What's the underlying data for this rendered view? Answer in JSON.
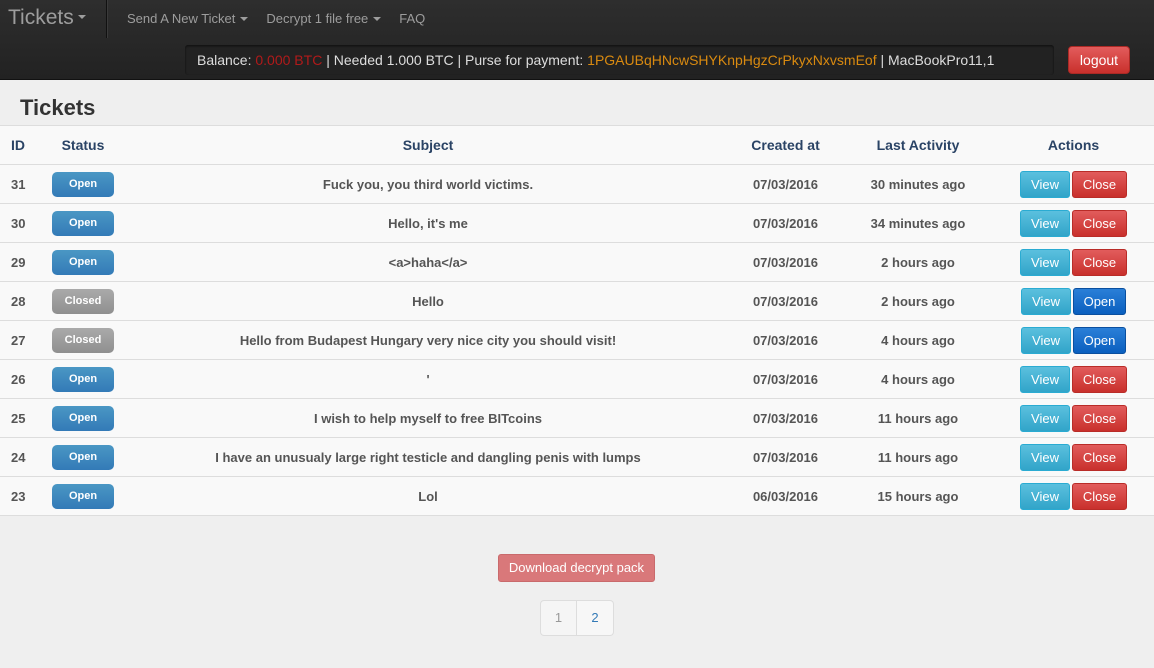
{
  "app": {
    "brand": "Tickets"
  },
  "nav": [
    {
      "label": "Send A New Ticket",
      "dropdown": true
    },
    {
      "label": "Decrypt 1 file free",
      "dropdown": true
    },
    {
      "label": "FAQ",
      "dropdown": false
    }
  ],
  "balance": {
    "label": "Balance:",
    "value": "0.000 BTC",
    "needed": "| Needed 1.000 BTC | Purse for payment:",
    "purse": "1PGAUBqHNcwSHYKnpHgzCrPkyxNxvsmEof",
    "machine": "| MacBookPro11,1"
  },
  "logout_label": "logout",
  "page_title": "Tickets",
  "columns": {
    "id": "ID",
    "status": "Status",
    "subject": "Subject",
    "created": "Created at",
    "last": "Last Activity",
    "actions": "Actions"
  },
  "rows": [
    {
      "id": "31",
      "status": "Open",
      "subject": "Fuck you, you third world victims.",
      "created": "07/03/2016",
      "last": "30 minutes ago",
      "view": "View",
      "action": "Close"
    },
    {
      "id": "30",
      "status": "Open",
      "subject": "Hello, it's me",
      "created": "07/03/2016",
      "last": "34 minutes ago",
      "view": "View",
      "action": "Close"
    },
    {
      "id": "29",
      "status": "Open",
      "subject": "<a>haha</a>",
      "created": "07/03/2016",
      "last": "2 hours ago",
      "view": "View",
      "action": "Close"
    },
    {
      "id": "28",
      "status": "Closed",
      "subject": "Hello",
      "created": "07/03/2016",
      "last": "2 hours ago",
      "view": "View",
      "action": "Open"
    },
    {
      "id": "27",
      "status": "Closed",
      "subject": "Hello from Budapest Hungary very nice city you should visit!",
      "created": "07/03/2016",
      "last": "4 hours ago",
      "view": "View",
      "action": "Open"
    },
    {
      "id": "26",
      "status": "Open",
      "subject": "'",
      "created": "07/03/2016",
      "last": "4 hours ago",
      "view": "View",
      "action": "Close"
    },
    {
      "id": "25",
      "status": "Open",
      "subject": "I wish to help myself to free BITcoins",
      "created": "07/03/2016",
      "last": "11 hours ago",
      "view": "View",
      "action": "Close"
    },
    {
      "id": "24",
      "status": "Open",
      "subject": "I have an unusualy large right testicle and dangling penis with lumps",
      "created": "07/03/2016",
      "last": "11 hours ago",
      "view": "View",
      "action": "Close"
    },
    {
      "id": "23",
      "status": "Open",
      "subject": "Lol",
      "created": "06/03/2016",
      "last": "15 hours ago",
      "view": "View",
      "action": "Close"
    }
  ],
  "download_label": "Download decrypt pack",
  "pagination": [
    "1",
    "2"
  ],
  "colors": {
    "open_badge": "#337ab7",
    "closed_badge": "#999999",
    "view_button": "#5bc0de",
    "close_button": "#d9534f",
    "open_button": "#0a6bd1",
    "balance_value": "#b11a1a",
    "purse_value": "#d98a10"
  }
}
